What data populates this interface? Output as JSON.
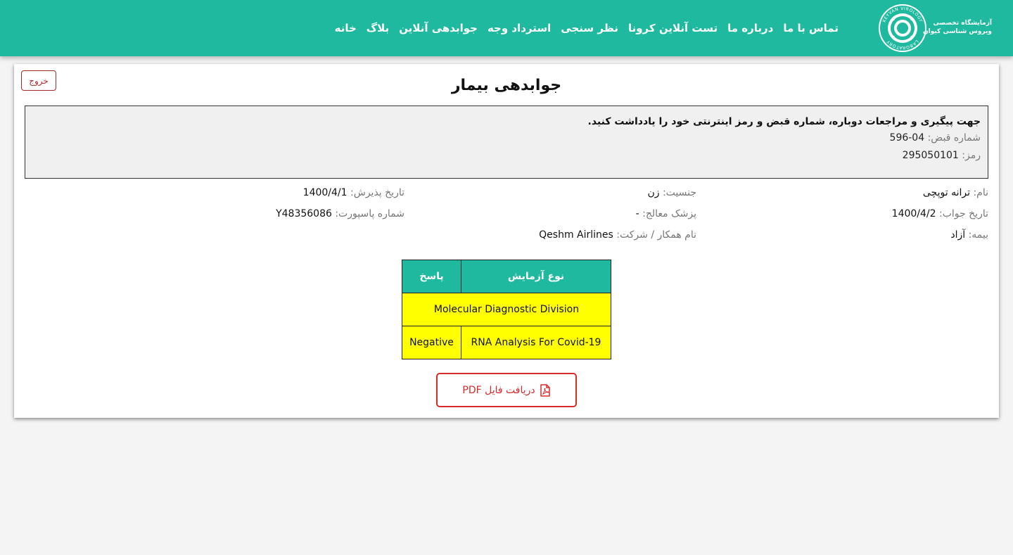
{
  "header": {
    "logo": {
      "ring_text_top": "KEYVAN VIROLOGY",
      "ring_text_bottom": "LABORATORY",
      "line1": "آزمایشگاه تخصصی",
      "line2": "ویروس شناسی کیوان"
    },
    "nav": [
      {
        "key": "home",
        "label": "خانه"
      },
      {
        "key": "blog",
        "label": "بلاگ"
      },
      {
        "key": "online-results",
        "label": "جوابدهی آنلاین"
      },
      {
        "key": "refund",
        "label": "استرداد وجه"
      },
      {
        "key": "survey",
        "label": "نظر سنجی"
      },
      {
        "key": "corona-test",
        "label": "تست آنلاین کرونا"
      },
      {
        "key": "about",
        "label": "درباره ما"
      },
      {
        "key": "contact",
        "label": "تماس با ما"
      }
    ]
  },
  "card": {
    "logout_label": "خروج",
    "title": "جوابدهی بیمار",
    "notice": {
      "title": "جهت پیگیری و مراجعات دوباره، شماره قبض و رمز اینترنتی خود را یادداشت کنید.",
      "receipt_label": "شماره قبض:",
      "receipt_value": "596-04",
      "password_label": "رمز:",
      "password_value": "295050101"
    },
    "info": {
      "name_label": "نام:",
      "name_value": "ترانه توپچی",
      "gender_label": "جنسیت:",
      "gender_value": "زن",
      "admission_label": "تاریخ پذیرش:",
      "admission_value": "1400/4/1",
      "result_date_label": "تاریخ جواب:",
      "result_date_value": "1400/4/2",
      "doctor_label": "پزشک معالج:",
      "doctor_value": "-",
      "passport_label": "شماره پاسپورت:",
      "passport_value": "Y48356086",
      "insurance_label": "بیمه:",
      "insurance_value": "آزاد",
      "company_label": "نام همکار / شرکت:",
      "company_value": "Qeshm Airlines"
    },
    "table": {
      "headers": {
        "test": "نوع آزمایش",
        "answer": "پاسخ"
      },
      "section": "Molecular Diagnostic Division",
      "rows": [
        {
          "test": "RNA Analysis For Covid-19",
          "answer": "Negative"
        }
      ]
    },
    "pdf_button": "دریافت فایل PDF"
  },
  "colors": {
    "header_bg": "#1fb9a0",
    "result_cell_bg": "#ffff00",
    "pdf_accent": "#d62b2b",
    "logout_accent": "#a52a2a"
  }
}
